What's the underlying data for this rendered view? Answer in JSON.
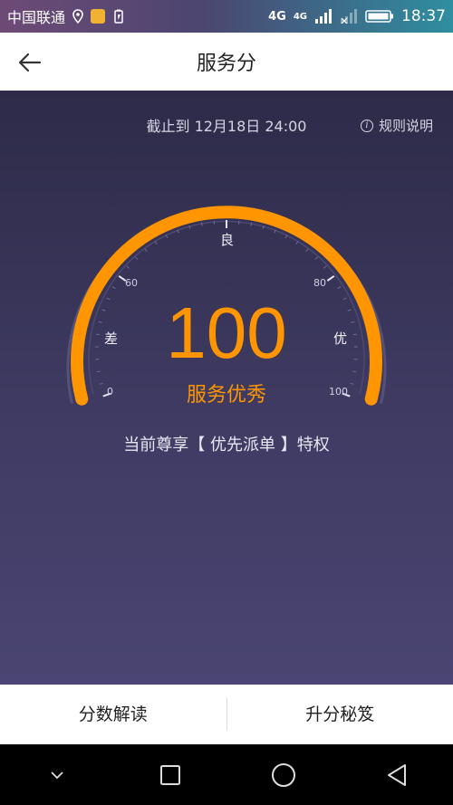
{
  "status_bar": {
    "carrier": "中国联通",
    "network_1": "4G",
    "network_2": "4G",
    "time": "18:37",
    "icons": [
      "location-icon",
      "notification-icon",
      "battery-saver-icon",
      "signal-icon",
      "wifi-off-icon",
      "battery-icon"
    ]
  },
  "header": {
    "title": "服务分",
    "back_icon": "back-arrow-icon"
  },
  "main": {
    "deadline": "截止到 12月18日 24:00",
    "rules_label": "规则说明",
    "rules_icon": "info-icon",
    "score": "100",
    "score_level": 1.0,
    "grade": "服务优秀",
    "privilege": "当前尊享【 优先派单 】特权",
    "tick_labels": [
      "0",
      "60",
      "80",
      "100"
    ],
    "grade_labels": [
      "差",
      "良",
      "优"
    ]
  },
  "bottom_tabs": {
    "left": "分数解读",
    "right": "升分秘笈"
  },
  "nav_bar": {
    "icons": [
      "chevron-down-icon",
      "recents-icon",
      "home-icon",
      "back-triangle-icon"
    ]
  },
  "colors": {
    "accent": "#ff9500",
    "background_top": "#2d2b48",
    "background_bottom": "#4a4572"
  }
}
